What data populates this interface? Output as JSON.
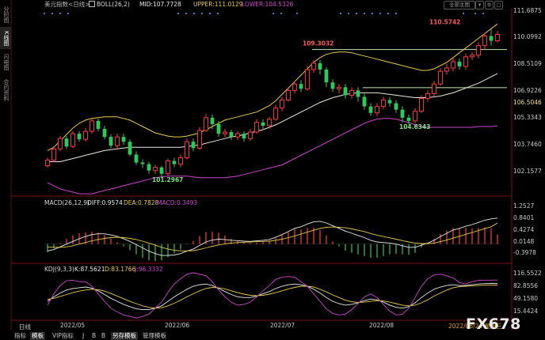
{
  "header": {
    "title": "美元指数<日线>",
    "boll_label": "BOLL(26,2)",
    "mid": "MID:107.7728",
    "upper": "UPPER:111.0129",
    "lower": "LOWER:104.5326",
    "button_all": "全部主图",
    "colors": {
      "title": "#d0d0d0",
      "mid": "#e8e8e8",
      "upper": "#e6c84a",
      "lower": "#cc44cc"
    }
  },
  "left_tabs": [
    {
      "label": "分时图",
      "active": false
    },
    {
      "label": "K线图",
      "active": true
    },
    {
      "label": "闪电图",
      "active": false
    },
    {
      "label": "合约资料",
      "active": false
    }
  ],
  "macd_header": {
    "name": "MACD(26,12,9)",
    "diff": "DIFF:0.9574",
    "dea": "DEA:0.7828",
    "macd": "MACD:0.3493"
  },
  "kdj_header": {
    "name": "KDJ(9,3,3)",
    "k": "K:87.5621",
    "d": "D:83.1766",
    "j": "J:96.3332"
  },
  "annotations": {
    "high_price": "110.5742",
    "level1": "109.3032",
    "level2": "106.5046",
    "low1": "101.2967",
    "low2": "104.6343"
  },
  "x_labels": [
    "2022/05",
    "2022/06",
    "2022/07",
    "2022/08",
    "2022/08/24 星期三"
  ],
  "bottom_tabs": [
    {
      "label": "日线",
      "selected": false
    },
    {
      "label": "指标",
      "selected": false
    },
    {
      "label": "模板",
      "selected": true
    },
    {
      "label": "VIP指标",
      "selected": false
    },
    {
      "label": "J",
      "selected": false
    },
    {
      "label": "B",
      "selected": false
    },
    {
      "label": "B",
      "selected": false
    },
    {
      "label": "另存模板",
      "selected": true
    },
    {
      "label": "管理模板",
      "selected": false
    }
  ],
  "logo_text": "FX678",
  "chart_data": {
    "type": "candlestick",
    "main_yticks": [
      "111.6875",
      "110.0992",
      "108.5109",
      "106.9226",
      "105.3343",
      "103.7460",
      "102.1577"
    ],
    "main_ylim": [
      100.55,
      111.9
    ],
    "macd_yticks": [
      "1.2527",
      "0.8401",
      "0.4274",
      "0.0148",
      "-0.3978"
    ],
    "macd_ylim": [
      -0.62,
      1.42
    ],
    "kdj_yticks": [
      "116.5522",
      "82.8556",
      "49.1580",
      "15.4424"
    ],
    "kdj_ylim": [
      -8,
      122
    ],
    "level_lines": [
      {
        "value": 109.3032,
        "from_index": 42,
        "to_index": 71
      },
      {
        "value": 106.9226,
        "from_index": 50,
        "to_index": 71
      }
    ],
    "candles": [
      [
        102.05,
        102.4,
        101.95,
        102.55
      ],
      [
        102.4,
        103.1,
        102.3,
        103.25
      ],
      [
        103.1,
        103.75,
        102.95,
        103.9
      ],
      [
        103.75,
        103.25,
        103.1,
        103.9
      ],
      [
        103.25,
        104.05,
        103.15,
        104.2
      ],
      [
        104.05,
        103.7,
        103.55,
        104.2
      ],
      [
        103.7,
        104.2,
        103.55,
        104.4
      ],
      [
        104.2,
        104.85,
        104.05,
        105.0
      ],
      [
        104.85,
        104.35,
        104.2,
        105.0
      ],
      [
        104.35,
        103.85,
        103.7,
        104.55
      ],
      [
        103.85,
        103.3,
        103.15,
        104.0
      ],
      [
        103.3,
        103.85,
        103.15,
        104.05
      ],
      [
        103.85,
        103.55,
        103.35,
        104.05
      ],
      [
        103.55,
        102.75,
        102.65,
        103.7
      ],
      [
        102.75,
        102.25,
        102.1,
        102.95
      ],
      [
        102.25,
        102.15,
        101.9,
        102.45
      ],
      [
        102.15,
        101.75,
        101.55,
        102.3
      ],
      [
        101.75,
        101.95,
        101.55,
        102.1
      ],
      [
        101.95,
        101.55,
        101.3,
        102.05
      ],
      [
        101.55,
        102.35,
        101.45,
        102.5
      ],
      [
        102.35,
        102.15,
        101.95,
        102.55
      ],
      [
        102.15,
        102.55,
        101.95,
        102.75
      ],
      [
        102.55,
        103.55,
        102.45,
        103.75
      ],
      [
        103.55,
        103.15,
        102.95,
        103.75
      ],
      [
        103.15,
        104.25,
        103.05,
        104.45
      ],
      [
        104.25,
        105.05,
        104.15,
        105.3
      ],
      [
        105.05,
        104.65,
        104.35,
        105.25
      ],
      [
        104.65,
        104.05,
        103.85,
        104.85
      ],
      [
        104.05,
        104.15,
        103.85,
        104.35
      ],
      [
        104.15,
        103.85,
        103.65,
        104.3
      ],
      [
        103.85,
        104.05,
        103.65,
        104.2
      ],
      [
        104.05,
        103.75,
        103.55,
        104.2
      ],
      [
        103.75,
        104.15,
        103.6,
        104.35
      ],
      [
        104.15,
        104.75,
        104.05,
        104.95
      ],
      [
        104.75,
        104.55,
        104.35,
        104.95
      ],
      [
        104.55,
        104.95,
        104.35,
        105.1
      ],
      [
        104.95,
        105.65,
        104.85,
        105.85
      ],
      [
        105.65,
        106.15,
        105.45,
        106.35
      ],
      [
        106.15,
        106.75,
        106.05,
        106.95
      ],
      [
        106.75,
        107.15,
        106.55,
        107.35
      ],
      [
        107.15,
        106.85,
        106.65,
        107.4
      ],
      [
        106.85,
        108.05,
        106.75,
        108.25
      ],
      [
        108.05,
        108.45,
        107.85,
        108.65
      ],
      [
        108.45,
        108.05,
        107.75,
        108.65
      ],
      [
        108.05,
        107.25,
        106.95,
        108.2
      ],
      [
        107.25,
        106.85,
        106.65,
        107.45
      ],
      [
        106.85,
        106.95,
        106.55,
        107.15
      ],
      [
        106.95,
        106.45,
        106.25,
        107.15
      ],
      [
        106.45,
        106.75,
        106.25,
        106.95
      ],
      [
        106.75,
        106.35,
        106.05,
        106.95
      ],
      [
        106.35,
        105.75,
        105.55,
        106.55
      ],
      [
        105.75,
        105.35,
        105.15,
        105.95
      ],
      [
        105.35,
        105.75,
        105.15,
        105.95
      ],
      [
        105.75,
        106.15,
        105.55,
        106.35
      ],
      [
        106.15,
        105.95,
        105.75,
        106.35
      ],
      [
        105.95,
        105.55,
        105.35,
        106.15
      ],
      [
        105.55,
        105.05,
        104.75,
        105.75
      ],
      [
        105.05,
        104.85,
        104.63,
        105.25
      ],
      [
        104.85,
        105.45,
        104.7,
        105.65
      ],
      [
        105.45,
        106.25,
        105.35,
        106.45
      ],
      [
        106.25,
        106.55,
        106.05,
        106.75
      ],
      [
        106.55,
        107.15,
        106.35,
        107.35
      ],
      [
        107.15,
        107.95,
        107.05,
        108.15
      ],
      [
        107.95,
        108.15,
        107.75,
        108.4
      ],
      [
        108.15,
        108.55,
        107.95,
        108.75
      ],
      [
        108.55,
        108.25,
        108.05,
        108.75
      ],
      [
        108.25,
        108.85,
        108.05,
        109.05
      ],
      [
        108.85,
        108.95,
        108.65,
        109.15
      ],
      [
        108.95,
        109.55,
        108.75,
        109.75
      ],
      [
        109.55,
        110.15,
        109.35,
        110.35
      ],
      [
        110.15,
        109.85,
        109.55,
        110.57
      ],
      [
        109.85,
        110.25,
        109.75,
        110.45
      ]
    ],
    "boll_upper": [
      103.0,
      103.2,
      103.6,
      104.0,
      104.4,
      104.7,
      104.9,
      105.0,
      105.05,
      105.1,
      105.1,
      105.1,
      105.0,
      104.9,
      104.7,
      104.5,
      104.3,
      104.1,
      104.0,
      103.9,
      103.85,
      103.85,
      103.9,
      104.0,
      104.1,
      104.3,
      104.5,
      104.7,
      104.9,
      105.0,
      105.1,
      105.2,
      105.3,
      105.4,
      105.6,
      105.8,
      106.1,
      106.5,
      106.9,
      107.3,
      107.7,
      108.1,
      108.5,
      108.8,
      109.0,
      109.1,
      109.15,
      109.15,
      109.1,
      109.0,
      108.9,
      108.8,
      108.7,
      108.6,
      108.5,
      108.4,
      108.3,
      108.2,
      108.1,
      108.0,
      108.0,
      108.1,
      108.3,
      108.5,
      108.8,
      109.1,
      109.4,
      109.7,
      110.0,
      110.3,
      110.6,
      110.9
    ],
    "boll_mid": [
      102.3,
      102.3,
      102.3,
      102.4,
      102.5,
      102.6,
      102.7,
      102.8,
      102.9,
      103.0,
      103.05,
      103.1,
      103.15,
      103.2,
      103.2,
      103.2,
      103.2,
      103.2,
      103.2,
      103.2,
      103.2,
      103.2,
      103.25,
      103.3,
      103.35,
      103.45,
      103.55,
      103.65,
      103.75,
      103.85,
      103.9,
      104.0,
      104.1,
      104.2,
      104.3,
      104.45,
      104.6,
      104.8,
      105.0,
      105.2,
      105.4,
      105.6,
      105.8,
      106.0,
      106.15,
      106.3,
      106.4,
      106.5,
      106.55,
      106.6,
      106.6,
      106.6,
      106.6,
      106.55,
      106.5,
      106.45,
      106.4,
      106.35,
      106.3,
      106.3,
      106.3,
      106.35,
      106.4,
      106.5,
      106.6,
      106.75,
      106.9,
      107.05,
      107.2,
      107.4,
      107.6,
      107.8
    ],
    "boll_lower": [
      101.0,
      100.8,
      100.6,
      100.5,
      100.4,
      100.3,
      100.3,
      100.3,
      100.4,
      100.5,
      100.6,
      100.7,
      100.8,
      100.9,
      101.0,
      101.1,
      101.2,
      101.3,
      101.35,
      101.4,
      101.4,
      101.4,
      101.4,
      101.35,
      101.3,
      101.3,
      101.3,
      101.3,
      101.3,
      101.35,
      101.4,
      101.5,
      101.6,
      101.7,
      101.8,
      101.9,
      102.0,
      102.1,
      102.3,
      102.5,
      102.7,
      102.9,
      103.1,
      103.3,
      103.5,
      103.7,
      103.9,
      104.1,
      104.3,
      104.5,
      104.7,
      104.85,
      104.95,
      105.0,
      105.0,
      104.95,
      104.85,
      104.75,
      104.6,
      104.5,
      104.45,
      104.45,
      104.45,
      104.45,
      104.45,
      104.45,
      104.45,
      104.45,
      104.5,
      104.5,
      104.5,
      104.53
    ],
    "macd_diff": [
      -0.25,
      -0.2,
      -0.1,
      0.0,
      0.1,
      0.2,
      0.28,
      0.35,
      0.38,
      0.38,
      0.34,
      0.28,
      0.2,
      0.1,
      -0.02,
      -0.14,
      -0.26,
      -0.35,
      -0.42,
      -0.42,
      -0.4,
      -0.35,
      -0.26,
      -0.18,
      -0.05,
      0.08,
      0.15,
      0.18,
      0.17,
      0.14,
      0.13,
      0.11,
      0.1,
      0.12,
      0.14,
      0.17,
      0.25,
      0.35,
      0.46,
      0.58,
      0.64,
      0.74,
      0.82,
      0.84,
      0.78,
      0.68,
      0.58,
      0.48,
      0.4,
      0.32,
      0.24,
      0.14,
      0.08,
      0.06,
      0.04,
      0.0,
      -0.06,
      -0.12,
      -0.12,
      -0.04,
      0.04,
      0.14,
      0.28,
      0.4,
      0.52,
      0.58,
      0.66,
      0.72,
      0.8,
      0.88,
      0.93,
      0.96
    ],
    "macd_dea": [
      -0.1,
      -0.12,
      -0.12,
      -0.1,
      -0.06,
      0.0,
      0.06,
      0.12,
      0.17,
      0.21,
      0.24,
      0.25,
      0.24,
      0.21,
      0.17,
      0.11,
      0.04,
      -0.04,
      -0.12,
      -0.18,
      -0.23,
      -0.25,
      -0.25,
      -0.24,
      -0.2,
      -0.14,
      -0.08,
      -0.03,
      0.01,
      0.04,
      0.06,
      0.07,
      0.08,
      0.09,
      0.1,
      0.11,
      0.14,
      0.18,
      0.24,
      0.3,
      0.37,
      0.44,
      0.51,
      0.58,
      0.62,
      0.63,
      0.62,
      0.6,
      0.56,
      0.51,
      0.46,
      0.39,
      0.33,
      0.28,
      0.23,
      0.18,
      0.13,
      0.08,
      0.04,
      0.02,
      0.02,
      0.04,
      0.09,
      0.15,
      0.22,
      0.29,
      0.36,
      0.43,
      0.5,
      0.57,
      0.64,
      0.78
    ],
    "macd_hist": [
      -0.3,
      -0.16,
      0.04,
      0.2,
      0.32,
      0.4,
      0.44,
      0.46,
      0.42,
      0.34,
      0.2,
      0.06,
      -0.08,
      -0.22,
      -0.38,
      -0.5,
      -0.6,
      -0.62,
      -0.6,
      -0.48,
      -0.34,
      -0.2,
      -0.02,
      0.12,
      0.3,
      0.44,
      0.46,
      0.42,
      0.32,
      0.2,
      0.14,
      0.08,
      0.04,
      0.06,
      0.08,
      0.12,
      0.22,
      0.34,
      0.44,
      0.56,
      0.54,
      0.6,
      0.62,
      0.52,
      0.32,
      0.1,
      -0.08,
      -0.24,
      -0.32,
      -0.38,
      -0.44,
      -0.5,
      -0.5,
      -0.44,
      -0.38,
      -0.36,
      -0.38,
      -0.4,
      -0.32,
      -0.12,
      0.04,
      0.2,
      0.38,
      0.5,
      0.6,
      0.58,
      0.6,
      0.58,
      0.6,
      0.62,
      0.58,
      0.35
    ],
    "kdj_k": [
      40,
      52,
      62,
      70,
      74,
      76,
      78,
      75,
      68,
      58,
      48,
      40,
      32,
      26,
      20,
      18,
      18,
      22,
      28,
      40,
      52,
      62,
      72,
      80,
      84,
      86,
      82,
      74,
      66,
      58,
      52,
      50,
      50,
      54,
      60,
      66,
      74,
      80,
      84,
      86,
      84,
      80,
      72,
      62,
      50,
      40,
      34,
      30,
      32,
      36,
      42,
      46,
      44,
      38,
      30,
      24,
      22,
      26,
      36,
      50,
      62,
      72,
      78,
      82,
      84,
      82,
      82,
      84,
      86,
      87,
      87.5,
      87.56
    ],
    "kdj_d": [
      45,
      48,
      53,
      58,
      63,
      67,
      70,
      72,
      71,
      67,
      61,
      54,
      47,
      40,
      34,
      28,
      24,
      22,
      23,
      28,
      35,
      43,
      52,
      60,
      68,
      74,
      77,
      76,
      73,
      68,
      63,
      59,
      56,
      55,
      56,
      59,
      63,
      68,
      73,
      77,
      80,
      80,
      78,
      72,
      65,
      57,
      50,
      43,
      39,
      37,
      38,
      40,
      42,
      41,
      38,
      34,
      30,
      28,
      30,
      36,
      44,
      54,
      62,
      70,
      76,
      79,
      80,
      81,
      82,
      83,
      83.1,
      83.18
    ],
    "kdj_j": [
      30,
      60,
      82,
      95,
      96,
      92,
      92,
      80,
      60,
      40,
      22,
      12,
      4,
      0,
      -4,
      0,
      6,
      22,
      38,
      64,
      86,
      100,
      112,
      116,
      112,
      108,
      92,
      70,
      52,
      38,
      30,
      32,
      38,
      52,
      68,
      82,
      98,
      104,
      106,
      104,
      92,
      80,
      60,
      40,
      20,
      8,
      4,
      6,
      18,
      34,
      52,
      60,
      50,
      32,
      14,
      4,
      6,
      22,
      50,
      80,
      100,
      110,
      112,
      108,
      102,
      90,
      86,
      92,
      96,
      96,
      96.3,
      96.33
    ]
  }
}
